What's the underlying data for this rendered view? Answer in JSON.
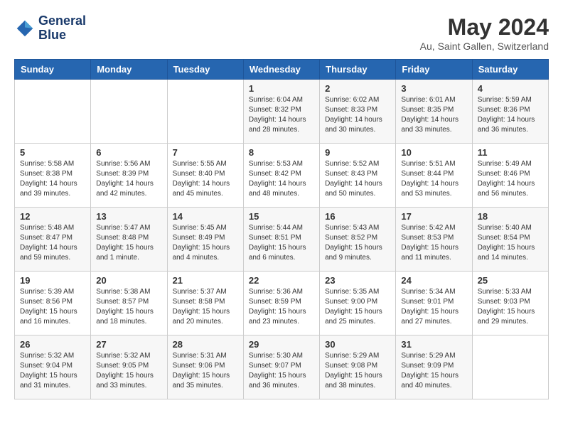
{
  "header": {
    "logo_line1": "General",
    "logo_line2": "Blue",
    "month_year": "May 2024",
    "location": "Au, Saint Gallen, Switzerland"
  },
  "days_of_week": [
    "Sunday",
    "Monday",
    "Tuesday",
    "Wednesday",
    "Thursday",
    "Friday",
    "Saturday"
  ],
  "weeks": [
    [
      {
        "day": "",
        "info": ""
      },
      {
        "day": "",
        "info": ""
      },
      {
        "day": "",
        "info": ""
      },
      {
        "day": "1",
        "info": "Sunrise: 6:04 AM\nSunset: 8:32 PM\nDaylight: 14 hours\nand 28 minutes."
      },
      {
        "day": "2",
        "info": "Sunrise: 6:02 AM\nSunset: 8:33 PM\nDaylight: 14 hours\nand 30 minutes."
      },
      {
        "day": "3",
        "info": "Sunrise: 6:01 AM\nSunset: 8:35 PM\nDaylight: 14 hours\nand 33 minutes."
      },
      {
        "day": "4",
        "info": "Sunrise: 5:59 AM\nSunset: 8:36 PM\nDaylight: 14 hours\nand 36 minutes."
      }
    ],
    [
      {
        "day": "5",
        "info": "Sunrise: 5:58 AM\nSunset: 8:38 PM\nDaylight: 14 hours\nand 39 minutes."
      },
      {
        "day": "6",
        "info": "Sunrise: 5:56 AM\nSunset: 8:39 PM\nDaylight: 14 hours\nand 42 minutes."
      },
      {
        "day": "7",
        "info": "Sunrise: 5:55 AM\nSunset: 8:40 PM\nDaylight: 14 hours\nand 45 minutes."
      },
      {
        "day": "8",
        "info": "Sunrise: 5:53 AM\nSunset: 8:42 PM\nDaylight: 14 hours\nand 48 minutes."
      },
      {
        "day": "9",
        "info": "Sunrise: 5:52 AM\nSunset: 8:43 PM\nDaylight: 14 hours\nand 50 minutes."
      },
      {
        "day": "10",
        "info": "Sunrise: 5:51 AM\nSunset: 8:44 PM\nDaylight: 14 hours\nand 53 minutes."
      },
      {
        "day": "11",
        "info": "Sunrise: 5:49 AM\nSunset: 8:46 PM\nDaylight: 14 hours\nand 56 minutes."
      }
    ],
    [
      {
        "day": "12",
        "info": "Sunrise: 5:48 AM\nSunset: 8:47 PM\nDaylight: 14 hours\nand 59 minutes."
      },
      {
        "day": "13",
        "info": "Sunrise: 5:47 AM\nSunset: 8:48 PM\nDaylight: 15 hours\nand 1 minute."
      },
      {
        "day": "14",
        "info": "Sunrise: 5:45 AM\nSunset: 8:49 PM\nDaylight: 15 hours\nand 4 minutes."
      },
      {
        "day": "15",
        "info": "Sunrise: 5:44 AM\nSunset: 8:51 PM\nDaylight: 15 hours\nand 6 minutes."
      },
      {
        "day": "16",
        "info": "Sunrise: 5:43 AM\nSunset: 8:52 PM\nDaylight: 15 hours\nand 9 minutes."
      },
      {
        "day": "17",
        "info": "Sunrise: 5:42 AM\nSunset: 8:53 PM\nDaylight: 15 hours\nand 11 minutes."
      },
      {
        "day": "18",
        "info": "Sunrise: 5:40 AM\nSunset: 8:54 PM\nDaylight: 15 hours\nand 14 minutes."
      }
    ],
    [
      {
        "day": "19",
        "info": "Sunrise: 5:39 AM\nSunset: 8:56 PM\nDaylight: 15 hours\nand 16 minutes."
      },
      {
        "day": "20",
        "info": "Sunrise: 5:38 AM\nSunset: 8:57 PM\nDaylight: 15 hours\nand 18 minutes."
      },
      {
        "day": "21",
        "info": "Sunrise: 5:37 AM\nSunset: 8:58 PM\nDaylight: 15 hours\nand 20 minutes."
      },
      {
        "day": "22",
        "info": "Sunrise: 5:36 AM\nSunset: 8:59 PM\nDaylight: 15 hours\nand 23 minutes."
      },
      {
        "day": "23",
        "info": "Sunrise: 5:35 AM\nSunset: 9:00 PM\nDaylight: 15 hours\nand 25 minutes."
      },
      {
        "day": "24",
        "info": "Sunrise: 5:34 AM\nSunset: 9:01 PM\nDaylight: 15 hours\nand 27 minutes."
      },
      {
        "day": "25",
        "info": "Sunrise: 5:33 AM\nSunset: 9:03 PM\nDaylight: 15 hours\nand 29 minutes."
      }
    ],
    [
      {
        "day": "26",
        "info": "Sunrise: 5:32 AM\nSunset: 9:04 PM\nDaylight: 15 hours\nand 31 minutes."
      },
      {
        "day": "27",
        "info": "Sunrise: 5:32 AM\nSunset: 9:05 PM\nDaylight: 15 hours\nand 33 minutes."
      },
      {
        "day": "28",
        "info": "Sunrise: 5:31 AM\nSunset: 9:06 PM\nDaylight: 15 hours\nand 35 minutes."
      },
      {
        "day": "29",
        "info": "Sunrise: 5:30 AM\nSunset: 9:07 PM\nDaylight: 15 hours\nand 36 minutes."
      },
      {
        "day": "30",
        "info": "Sunrise: 5:29 AM\nSunset: 9:08 PM\nDaylight: 15 hours\nand 38 minutes."
      },
      {
        "day": "31",
        "info": "Sunrise: 5:29 AM\nSunset: 9:09 PM\nDaylight: 15 hours\nand 40 minutes."
      },
      {
        "day": "",
        "info": ""
      }
    ]
  ]
}
